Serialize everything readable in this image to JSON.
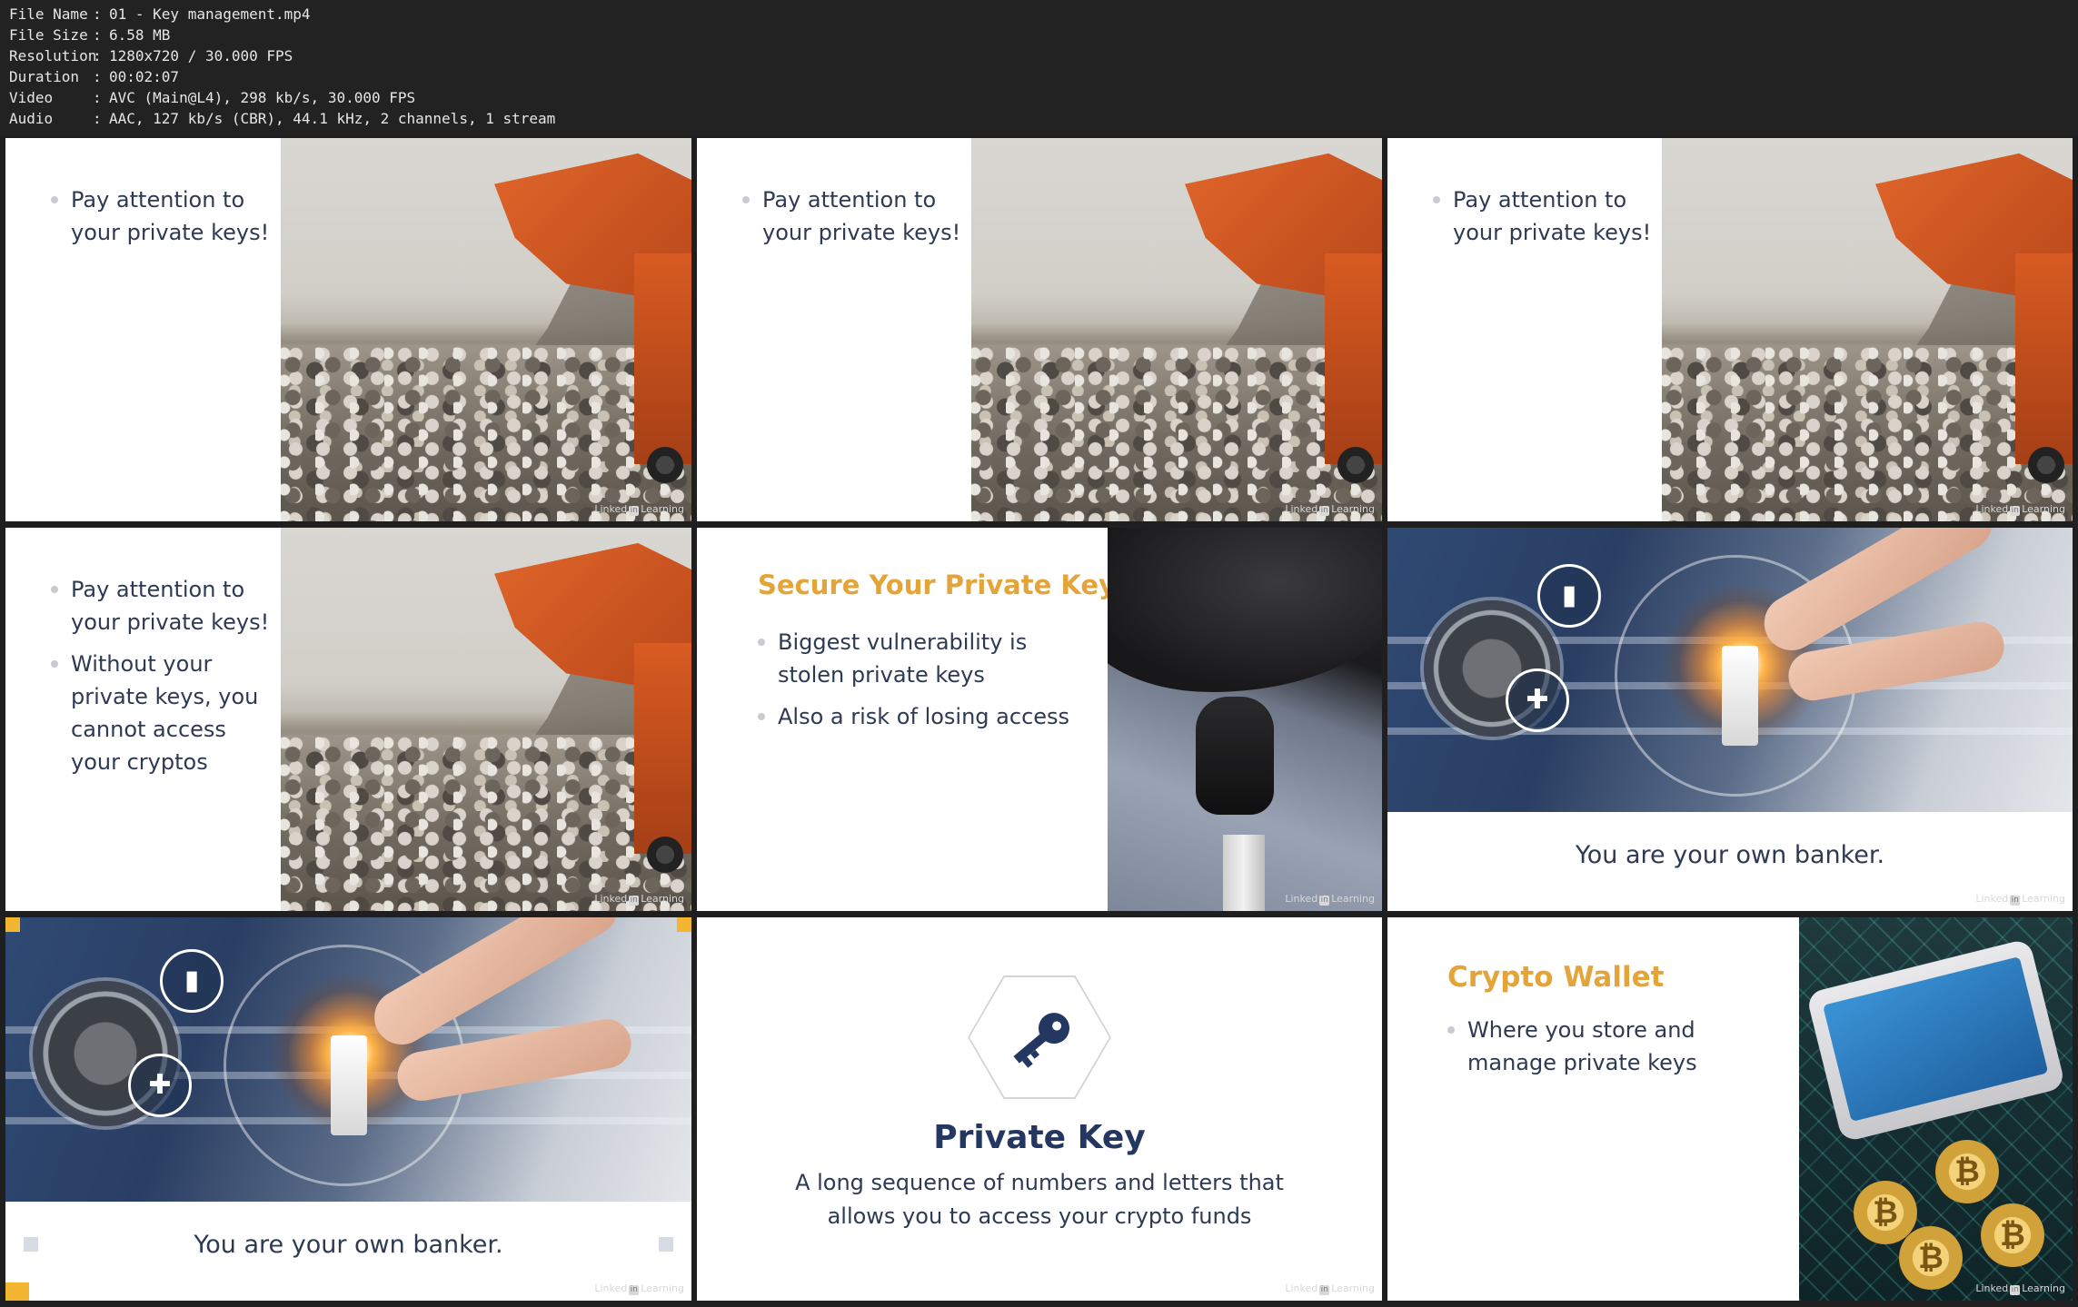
{
  "file_info": [
    {
      "key": "File Name",
      "value": "01 - Key management.mp4"
    },
    {
      "key": "File Size",
      "value": "6.58 MB"
    },
    {
      "key": "Resolution",
      "value": "1280x720 / 30.000 FPS"
    },
    {
      "key": "Duration",
      "value": "00:02:07"
    },
    {
      "key": "Video",
      "value": "AVC (Main@L4), 298 kb/s, 30.000 FPS"
    },
    {
      "key": "Audio",
      "value": "AAC, 127 kb/s (CBR), 44.1 kHz, 2 channels, 1 stream"
    }
  ],
  "watermark": {
    "pre": "Linked",
    "in": "in",
    "post": "Learning"
  },
  "frames": {
    "f1": {
      "bullets": [
        "Pay attention to your private keys!"
      ]
    },
    "f2": {
      "bullets": [
        "Pay attention to your private keys!"
      ]
    },
    "f3": {
      "bullets": [
        "Pay attention to your private keys!"
      ]
    },
    "f4": {
      "bullets": [
        "Pay attention to your private keys!",
        "Without your private keys, you cannot access your cryptos"
      ]
    },
    "f5": {
      "heading": "Secure Your Private Keys",
      "bullets": [
        "Biggest vulnerability is stolen private keys",
        "Also a risk of losing access"
      ]
    },
    "f6": {
      "caption": "You are your own banker."
    },
    "f7": {
      "caption": "You are your own banker."
    },
    "f8": {
      "title": "Private Key",
      "line1": "A long sequence of numbers and letters that",
      "line2": "allows you to access your crypto funds"
    },
    "f9": {
      "heading": "Crypto Wallet",
      "bullets": [
        "Where you store and manage private keys"
      ]
    }
  },
  "colors": {
    "accent": "#e3a43a",
    "text": "#2e3a54",
    "title": "#233760"
  }
}
